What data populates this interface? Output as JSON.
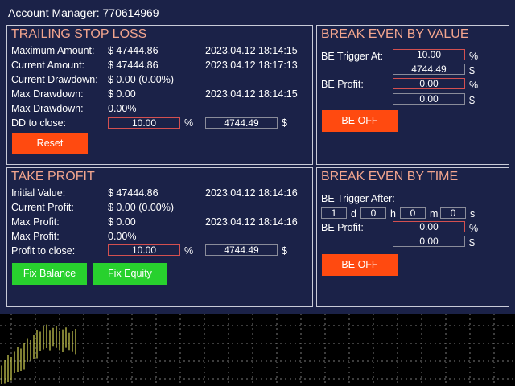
{
  "window": {
    "title": "Account Manager: 770614969"
  },
  "colors": {
    "background": "#1b2248",
    "panel_title": "#f2a58e",
    "orange_button": "#ff4a10",
    "green_button": "#28d12e",
    "field_border_red": "#d45050",
    "field_border_grey": "#8a8c9a",
    "chart_candle": "#ffff66"
  },
  "trailing": {
    "title": "TRAILING STOP LOSS",
    "rows": [
      {
        "label": "Maximum Amount:",
        "value": "$ 47444.86",
        "time": "2023.04.12 18:14:15"
      },
      {
        "label": "Current Amount:",
        "value": "$ 47444.86",
        "time": "2023.04.12 18:17:13"
      },
      {
        "label": "Current Drawdown:",
        "value": "$ 0.00 (0.00%)",
        "time": ""
      },
      {
        "label": "Max Drawdown:",
        "value": "$ 0.00",
        "time": "2023.04.12 18:14:15"
      },
      {
        "label": "Max Drawdown:",
        "value": "0.00%",
        "time": ""
      }
    ],
    "close_label": "DD to close:",
    "close_percent": "10.00",
    "percent_unit": "%",
    "close_amount": "4744.49",
    "dollar_unit": "$",
    "reset_label": "Reset"
  },
  "take_profit": {
    "title": "TAKE PROFIT",
    "rows": [
      {
        "label": "Initial Value:",
        "value": "$ 47444.86",
        "time": "2023.04.12 18:14:16"
      },
      {
        "label": "Current Profit:",
        "value": "$ 0.00 (0.00%)",
        "time": ""
      },
      {
        "label": "Max Profit:",
        "value": "$ 0.00",
        "time": "2023.04.12 18:14:16"
      },
      {
        "label": "Max Profit:",
        "value": "0.00%",
        "time": ""
      }
    ],
    "close_label": "Profit to close:",
    "close_percent": "10.00",
    "percent_unit": "%",
    "close_amount": "4744.49",
    "dollar_unit": "$",
    "fix_balance_label": "Fix Balance",
    "fix_equity_label": "Fix Equity"
  },
  "be_value": {
    "title": "BREAK EVEN BY VALUE",
    "trigger_label": "BE Trigger At:",
    "trigger_percent": "10.00",
    "trigger_amount": "4744.49",
    "profit_label": "BE Profit:",
    "profit_percent": "0.00",
    "profit_amount": "0.00",
    "percent_unit": "%",
    "dollar_unit": "$",
    "button_label": "BE OFF"
  },
  "be_time": {
    "title": "BREAK EVEN BY TIME",
    "trigger_label": "BE Trigger After:",
    "days": "1",
    "days_unit": "d",
    "hours": "0",
    "hours_unit": "h",
    "minutes": "0",
    "minutes_unit": "m",
    "seconds": "0",
    "seconds_unit": "s",
    "profit_label": "BE Profit:",
    "profit_percent": "0.00",
    "profit_amount": "0.00",
    "percent_unit": "%",
    "dollar_unit": "$",
    "button_label": "BE OFF"
  }
}
